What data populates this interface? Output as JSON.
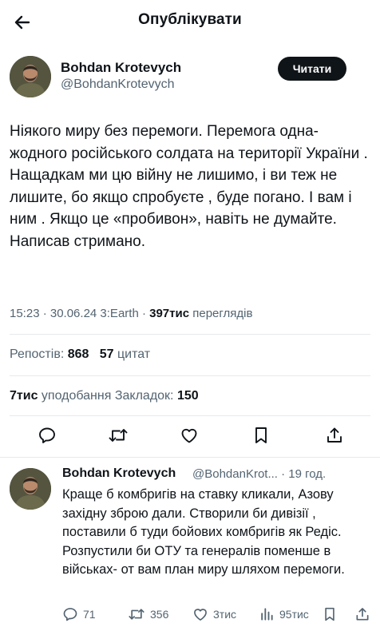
{
  "header": {
    "title": "Опублікувати"
  },
  "post": {
    "author": {
      "name": "Bohdan Krotevych",
      "handle": "@BohdanKrotevych"
    },
    "follow_label": "Читати",
    "text": "Ніякого миру  без перемоги. Перемога одна- жодного російського солдата на території України .  Нащадкам ми цю війну не лишимо, і ви теж не лишите, бо якщо спробуєте , буде погано. І вам і ним . Якщо це «пробивон», навіть не думайте.\nНаписав  стримано.",
    "time": "15:23 · 30.06.24 3:Earth · ",
    "views_count": "397тис",
    "views_label": " переглядів",
    "reposts_label": "Репостів: ",
    "reposts_count": "868",
    "quotes_count": "57",
    "quotes_label": " цитат",
    "likes_count": "7тис",
    "likes_label": " уподобання  ",
    "bookmarks_label": "Закладок: ",
    "bookmarks_count": "150"
  },
  "reply": {
    "author": {
      "name": "Bohdan Krotevych",
      "handle": "@BohdanKrot... · 19 год."
    },
    "text": "Краще б комбригів на ставку кликали, Азову західну зброю дали. Створили би дивізії , поставили б туди бойових комбригів як Редіс. Розпустили би ОТУ та  генералів поменше в військах- от вам план миру шляхом перемоги.",
    "replies": "71",
    "reposts": "356",
    "likes": "3тис",
    "views": "95тис"
  },
  "colors": {
    "text": "#0f1419",
    "secondary": "#536471",
    "divider": "#e6e9ec",
    "button": "#0f1419"
  },
  "icons": [
    "back-arrow-icon",
    "reply-icon",
    "repost-icon",
    "like-icon",
    "bookmark-icon",
    "share-icon",
    "views-icon"
  ]
}
